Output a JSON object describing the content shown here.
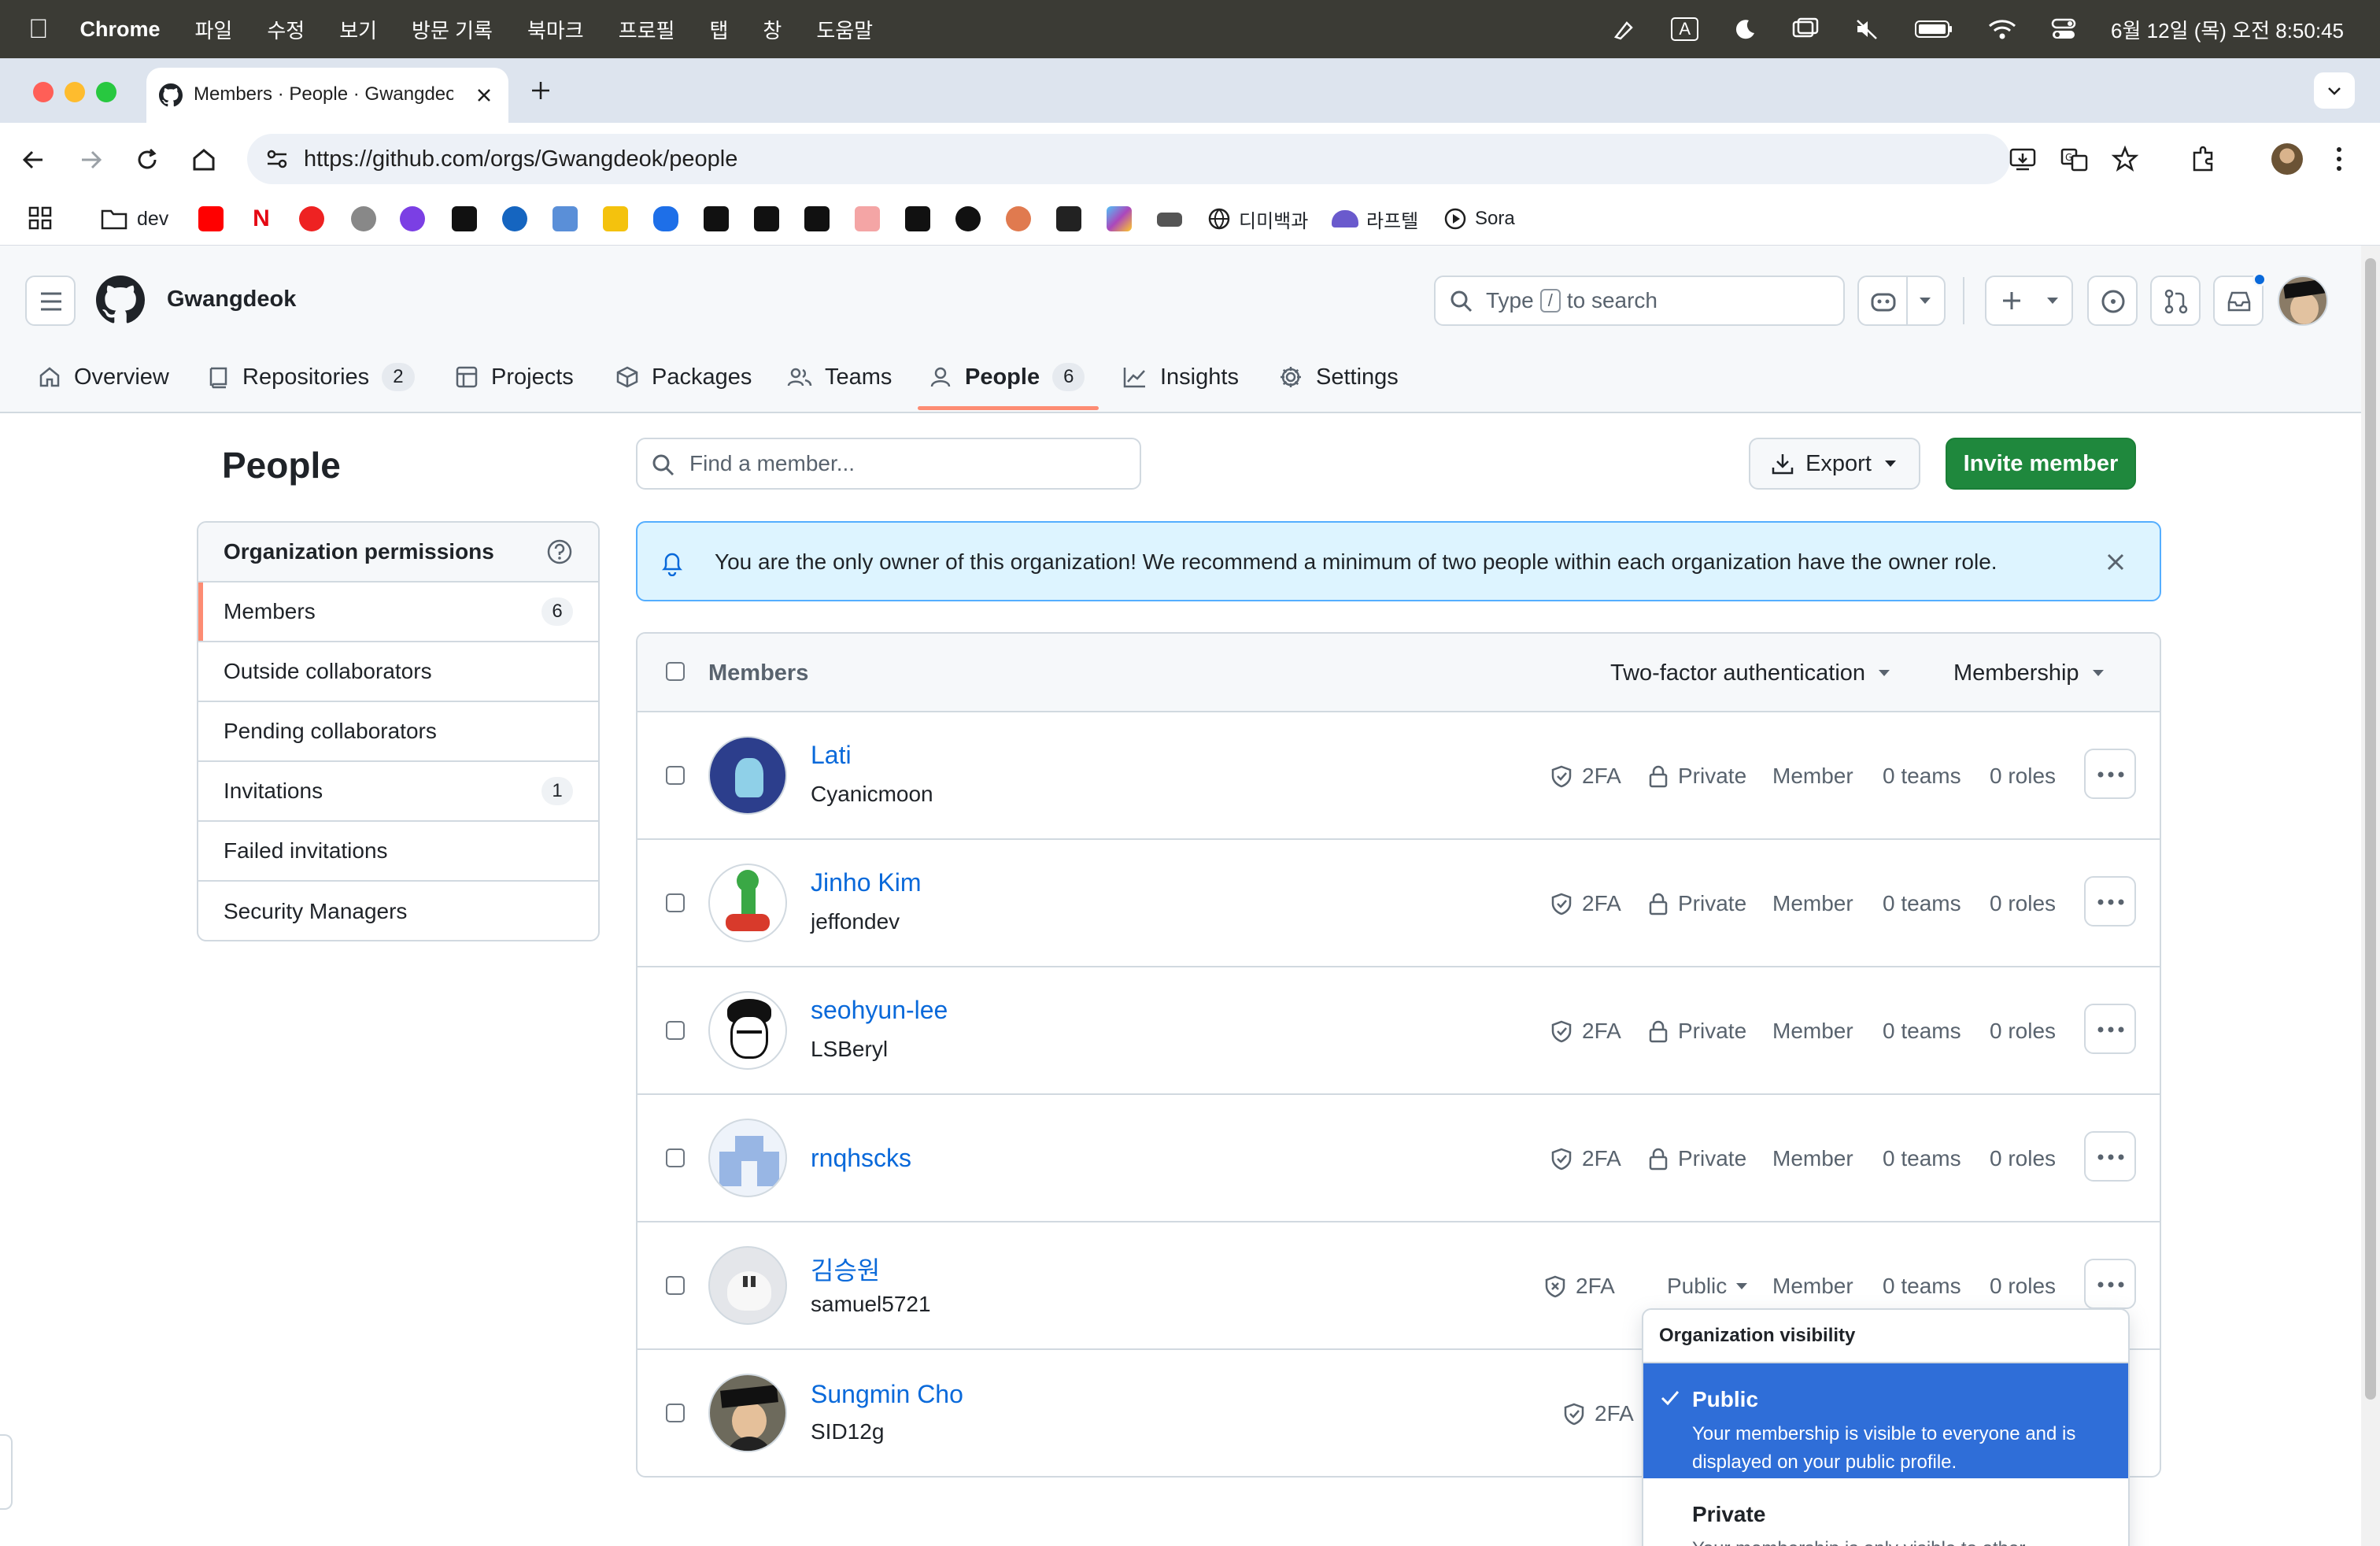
{
  "mac_menu": {
    "app": "Chrome",
    "items": [
      "파일",
      "수정",
      "보기",
      "방문 기록",
      "북마크",
      "프로필",
      "탭",
      "창",
      "도움말"
    ],
    "clock": "6월 12일 (목) 오전 8:50:45",
    "input_indicator": "A"
  },
  "browser": {
    "tab_title": "Members · People · Gwangdeok",
    "url": "https://github.com/orgs/Gwangdeok/people",
    "bookmarks": [
      {
        "label": "dev"
      },
      {
        "label": "디미백과"
      },
      {
        "label": "라프텔"
      },
      {
        "label": "Sora"
      }
    ]
  },
  "gh_header": {
    "org_name": "Gwangdeok",
    "search_prefix": "Type",
    "search_key": "/",
    "search_suffix": "to search",
    "nav": [
      {
        "label": "Overview",
        "icon": "home-icon"
      },
      {
        "label": "Repositories",
        "count": "2",
        "icon": "repo-icon"
      },
      {
        "label": "Projects",
        "icon": "table-icon"
      },
      {
        "label": "Packages",
        "icon": "package-icon"
      },
      {
        "label": "Teams",
        "icon": "people-icon"
      },
      {
        "label": "People",
        "count": "6",
        "icon": "person-icon",
        "selected": true
      },
      {
        "label": "Insights",
        "icon": "graph-icon"
      },
      {
        "label": "Settings",
        "icon": "gear-icon"
      }
    ]
  },
  "page": {
    "title": "People",
    "find_placeholder": "Find a member...",
    "export_label": "Export",
    "invite_label": "Invite member",
    "alert": "You are the only owner of this organization! We recommend a minimum of two people within each organization have the owner role."
  },
  "sidebar": {
    "heading": "Organization permissions",
    "items": [
      {
        "label": "Members",
        "count": "6",
        "selected": true
      },
      {
        "label": "Outside collaborators"
      },
      {
        "label": "Pending collaborators"
      },
      {
        "label": "Invitations",
        "count": "1"
      },
      {
        "label": "Failed invitations"
      },
      {
        "label": "Security Managers"
      }
    ]
  },
  "table": {
    "header_label": "Members",
    "filter_2fa": "Two-factor authentication",
    "filter_membership": "Membership",
    "members": [
      {
        "name": "Lati",
        "login": "Cyanicmoon",
        "twofa": "2FA",
        "visibility": "Private",
        "role": "Member",
        "teams": "0 teams",
        "roles": "0 roles"
      },
      {
        "name": "Jinho Kim",
        "login": "jeffondev",
        "twofa": "2FA",
        "visibility": "Private",
        "role": "Member",
        "teams": "0 teams",
        "roles": "0 roles"
      },
      {
        "name": "seohyun-lee",
        "login": "LSBeryl",
        "twofa": "2FA",
        "visibility": "Private",
        "role": "Member",
        "teams": "0 teams",
        "roles": "0 roles"
      },
      {
        "name": "rnqhscks",
        "login": "",
        "twofa": "2FA",
        "visibility": "Private",
        "role": "Member",
        "teams": "0 teams",
        "roles": "0 roles"
      },
      {
        "name": "김승원",
        "login": "samuel5721",
        "twofa": "2FA",
        "visibility": "Public",
        "role": "Member",
        "teams": "0 teams",
        "roles": "0 roles"
      },
      {
        "name": "Sungmin Cho",
        "login": "SID12g",
        "twofa": "2FA"
      }
    ]
  },
  "visibility_menu": {
    "heading": "Organization visibility",
    "options": [
      {
        "title": "Public",
        "desc": "Your membership is visible to everyone and is displayed on your public profile.",
        "selected": true
      },
      {
        "title": "Private",
        "desc": "Your membership is only visible to other"
      }
    ]
  },
  "colors": {
    "accent_link": "#0969da",
    "primary_button": "#1f883d",
    "selected_nav_underline": "#fd8c73",
    "dropdown_selected": "#2f6ed8",
    "alert_bg": "#ddf4ff"
  }
}
